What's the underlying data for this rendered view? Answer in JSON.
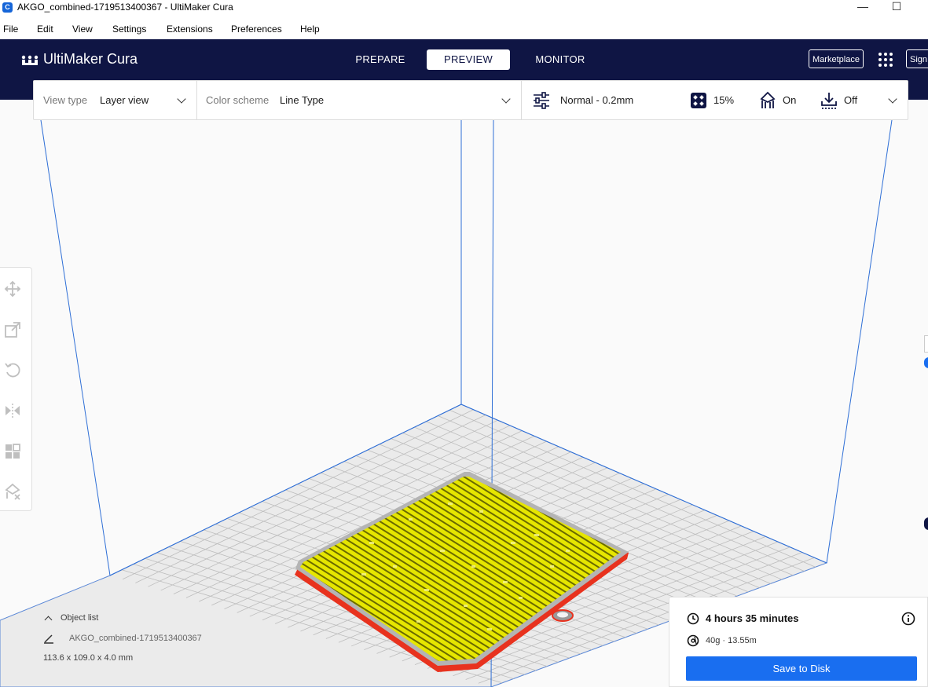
{
  "window": {
    "title": "AKGO_combined-1719513400367 - UltiMaker Cura",
    "app_icon_letter": "C",
    "minimize_glyph": "—",
    "maximize_glyph": "☐"
  },
  "menu": [
    "File",
    "Edit",
    "View",
    "Settings",
    "Extensions",
    "Preferences",
    "Help"
  ],
  "header": {
    "logo_text": "UltiMaker Cura",
    "stages": [
      "PREPARE",
      "PREVIEW",
      "MONITOR"
    ],
    "active_stage": "PREVIEW",
    "marketplace_label": "Marketplace",
    "signin_label": "Sign in"
  },
  "view_bar": {
    "view_type_label": "View type",
    "view_type_value": "Layer view",
    "color_scheme_label": "Color scheme",
    "color_scheme_value": "Line Type",
    "profile": "Normal - 0.2mm",
    "infill": "15%",
    "support": "On",
    "adhesion": "Off"
  },
  "toolbar": {
    "tools": [
      "move-icon",
      "scale-icon",
      "rotate-icon",
      "mirror-icon",
      "per-model-settings-icon",
      "support-blocker-icon"
    ]
  },
  "object_list": {
    "header": "Object list",
    "object_name": "AKGO_combined-1719513400367",
    "dimensions": "113.6 x 109.0 x 4.0 mm"
  },
  "print_info": {
    "time": "4 hours 35 minutes",
    "material": "40g · 13.55m",
    "save_label": "Save to Disk"
  },
  "colors": {
    "header_bg": "#0f1544",
    "accent_blue": "#196ef0",
    "infill_yellow": "#e8e800",
    "wall_red": "#e8321e",
    "support_gray": "#b4b4b4"
  }
}
